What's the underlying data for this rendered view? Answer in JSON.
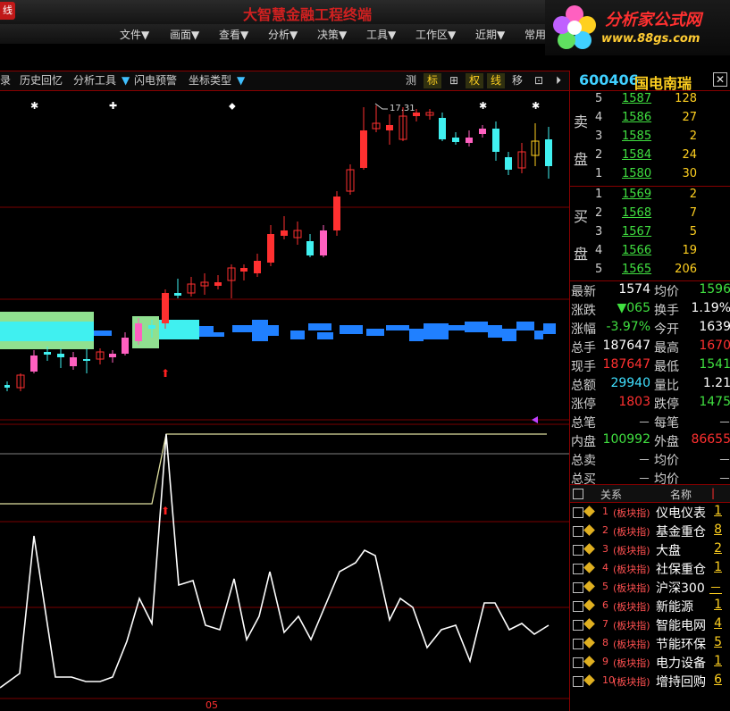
{
  "app": {
    "window_tab": "线",
    "title": "大智慧金融工程终端",
    "logo_text": "分析家公式网",
    "logo_url": "www.88gs.com"
  },
  "menu": [
    "文件▼",
    "画面▼",
    "查看▼",
    "分析▼",
    "决策▼",
    "工具▼",
    "工作区▼",
    "近期▼",
    "常用"
  ],
  "toolbar": {
    "left": [
      "录",
      "历史回忆",
      "分析工具",
      "闪电预警",
      "坐标类型"
    ],
    "right": [
      "测",
      "标",
      "⊞",
      "权",
      "线",
      "移",
      "⊡",
      "⏵"
    ]
  },
  "chart": {
    "high_label": "17.31",
    "x_label": "05"
  },
  "stock": {
    "code": "600406",
    "name": "国电南瑞",
    "close_icon": "close-icon"
  },
  "sell": {
    "label_a": "卖",
    "label_b": "盘",
    "rows": [
      {
        "lvl": "5",
        "price": "1587",
        "vol": "128"
      },
      {
        "lvl": "4",
        "price": "1586",
        "vol": "27"
      },
      {
        "lvl": "3",
        "price": "1585",
        "vol": "2"
      },
      {
        "lvl": "2",
        "price": "1584",
        "vol": "24"
      },
      {
        "lvl": "1",
        "price": "1580",
        "vol": "30"
      }
    ]
  },
  "buy": {
    "label_a": "买",
    "label_b": "盘",
    "rows": [
      {
        "lvl": "1",
        "price": "1569",
        "vol": "2"
      },
      {
        "lvl": "2",
        "price": "1568",
        "vol": "7"
      },
      {
        "lvl": "3",
        "price": "1567",
        "vol": "5"
      },
      {
        "lvl": "4",
        "price": "1566",
        "vol": "19"
      },
      {
        "lvl": "5",
        "price": "1565",
        "vol": "206"
      }
    ]
  },
  "stats": [
    {
      "k1": "最新",
      "v1": "1574",
      "c1": "#ffffff",
      "k2": "均价",
      "v2": "1596",
      "c2": "#40e040"
    },
    {
      "k1": "涨跌",
      "v1": "▼065",
      "c1": "#40e040",
      "k2": "换手",
      "v2": "1.19%",
      "c2": "#ffffff"
    },
    {
      "k1": "涨幅",
      "v1": "-3.97%",
      "c1": "#40e040",
      "k2": "今开",
      "v2": "1639",
      "c2": "#ffffff"
    },
    {
      "k1": "总手",
      "v1": "187647",
      "c1": "#ffffff",
      "k2": "最高",
      "v2": "1670",
      "c2": "#ff3030"
    },
    {
      "k1": "现手",
      "v1": "187647",
      "c1": "#ff3030",
      "k2": "最低",
      "v2": "1541",
      "c2": "#40e040"
    },
    {
      "k1": "总额",
      "v1": "29940",
      "c1": "#40e0ff",
      "k2": "量比",
      "v2": "1.21",
      "c2": "#ffffff"
    },
    {
      "k1": "涨停",
      "v1": "1803",
      "c1": "#ff3030",
      "k2": "跌停",
      "v2": "1475",
      "c2": "#40e040"
    },
    {
      "k1": "总笔",
      "v1": "－",
      "c1": "#c0c0c0",
      "k2": "每笔",
      "v2": "－",
      "c2": "#c0c0c0"
    },
    {
      "k1": "内盘",
      "v1": "100992",
      "c1": "#40e040",
      "k2": "外盘",
      "v2": "86655",
      "c2": "#ff3030"
    },
    {
      "k1": "总卖",
      "v1": "－",
      "c1": "#c0c0c0",
      "k2": "均价",
      "v2": "－",
      "c2": "#c0c0c0"
    },
    {
      "k1": "总买",
      "v1": "－",
      "c1": "#c0c0c0",
      "k2": "均价",
      "v2": "－",
      "c2": "#c0c0c0"
    }
  ],
  "blocks": {
    "header": [
      "关系",
      "名称"
    ],
    "rows": [
      {
        "idx": "1",
        "tag": "(板块指)",
        "name": "仪电仪表",
        "val": "1"
      },
      {
        "idx": "2",
        "tag": "(板块指)",
        "name": "基金重仓",
        "val": "8"
      },
      {
        "idx": "3",
        "tag": "(板块指)",
        "name": "大盘",
        "val": "2"
      },
      {
        "idx": "4",
        "tag": "(板块指)",
        "name": "社保重仓",
        "val": "1"
      },
      {
        "idx": "5",
        "tag": "(板块指)",
        "name": "沪深300",
        "val": "－"
      },
      {
        "idx": "6",
        "tag": "(板块指)",
        "name": "新能源",
        "val": "1"
      },
      {
        "idx": "7",
        "tag": "(板块指)",
        "name": "智能电网",
        "val": "4"
      },
      {
        "idx": "8",
        "tag": "(板块指)",
        "name": "节能环保",
        "val": "5"
      },
      {
        "idx": "9",
        "tag": "(板块指)",
        "name": "电力设备",
        "val": "1"
      },
      {
        "idx": "10",
        "tag": "(板块指)",
        "name": "增持回购",
        "val": "6"
      }
    ]
  }
}
